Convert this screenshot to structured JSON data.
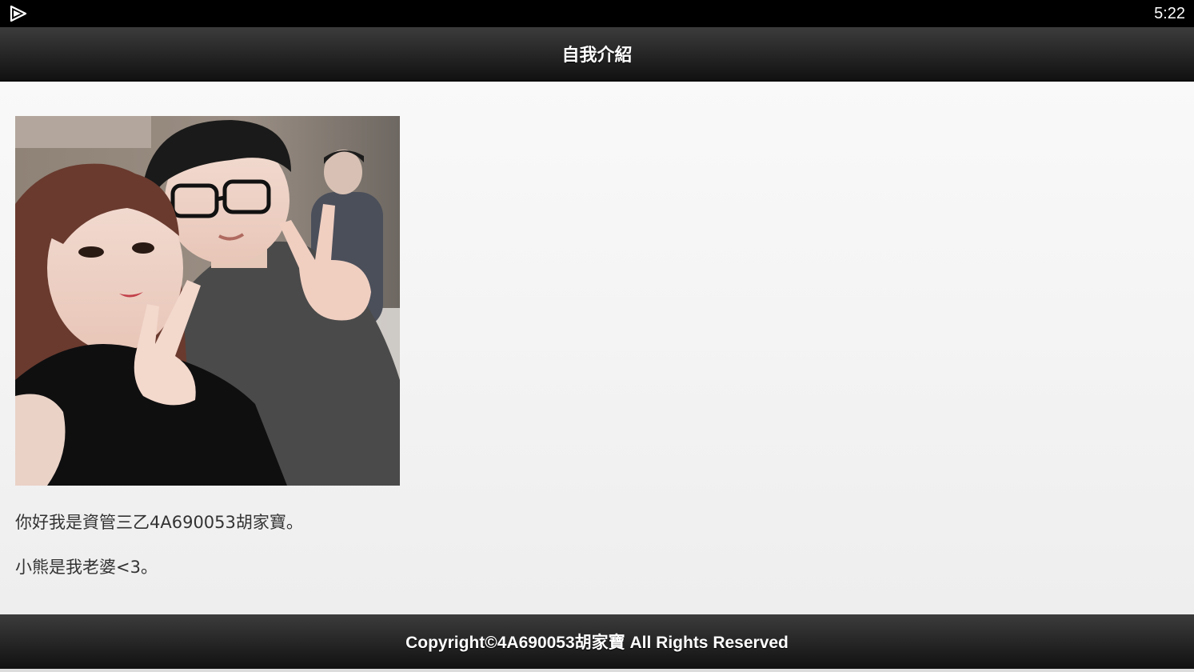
{
  "status_bar": {
    "app_icon": "play-icon",
    "time": "5:22"
  },
  "header": {
    "title": "自我介紹"
  },
  "main": {
    "photo": {
      "subject": "photo-of-two-people"
    },
    "paragraphs": [
      "你好我是資管三乙4A690053胡家寶。",
      "小熊是我老婆<3。"
    ]
  },
  "footer": {
    "copyright": "Copyright©4A690053胡家寶 All Rights Reserved"
  },
  "colors": {
    "bar_dark": "#111111",
    "bar_light": "#3c3c3c",
    "text_light": "#ffffff",
    "text_dark": "#333333",
    "background": "#f2f2f2"
  }
}
